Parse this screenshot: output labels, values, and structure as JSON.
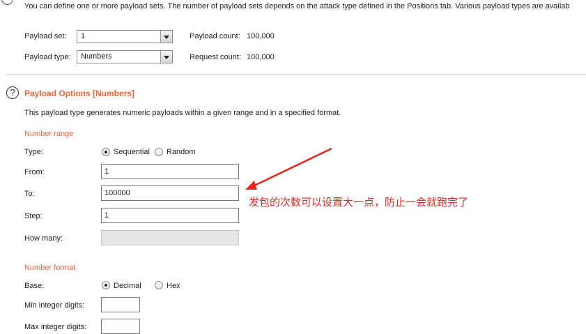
{
  "intro_text": "You can define one or more payload sets. The number of payload sets depends on the attack type defined in the Positions tab. Various payload types are availab",
  "payload_set": {
    "label": "Payload set:",
    "value": "1",
    "count_label": "Payload count:",
    "count_value": "100,000"
  },
  "payload_type": {
    "label": "Payload type:",
    "value": "Numbers",
    "count_label": "Request count:",
    "count_value": "100,000"
  },
  "options": {
    "help_glyph": "?",
    "title": "Payload Options [Numbers]",
    "description": "This payload type generates numeric payloads within a given range and in a specified format."
  },
  "number_range": {
    "heading": "Number range",
    "type_label": "Type:",
    "sequential_label": "Sequential",
    "random_label": "Random",
    "selected": "Sequential",
    "from_label": "From:",
    "from_value": "1",
    "to_label": "To:",
    "to_value": "100000",
    "step_label": "Step:",
    "step_value": "1",
    "how_many_label": "How many:",
    "how_many_value": ""
  },
  "number_format": {
    "heading": "Number format",
    "base_label": "Base:",
    "decimal_label": "Decimal",
    "hex_label": "Hex",
    "selected": "Decimal",
    "min_int_label": "Min integer digits:",
    "min_int_value": "",
    "max_int_label": "Max integer digits:",
    "max_int_value": ""
  },
  "annotation": {
    "text": "发包的次数可以设置大一点，防止一会就跑完了",
    "color": "#e8231d"
  },
  "colors": {
    "accent": "#e8683a",
    "annotation": "#e8231d"
  }
}
